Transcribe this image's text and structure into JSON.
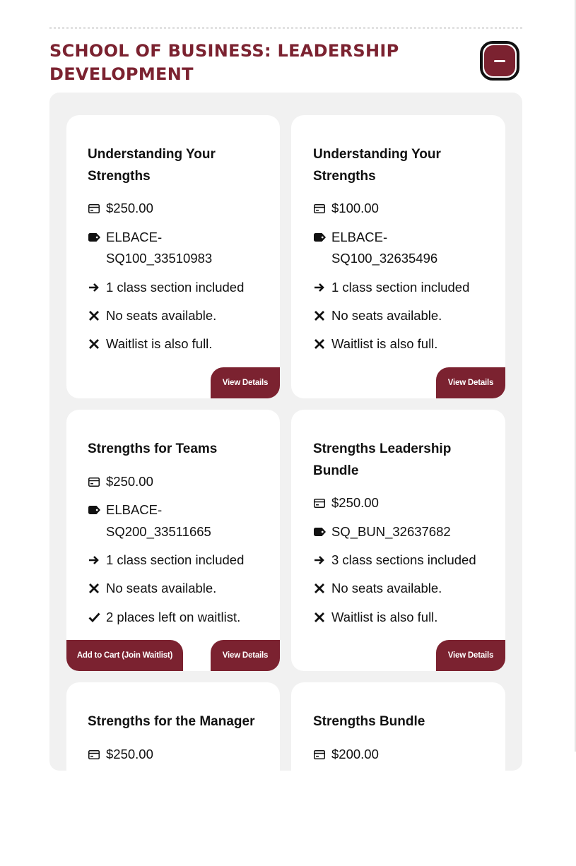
{
  "section": {
    "title": "School of Business: Leadership Development"
  },
  "cards": [
    {
      "title": "Understanding Your Strengths",
      "price": "$250.00",
      "code_line1": "ELBACE-",
      "code_line2": "SQ100_33510983",
      "sections": "1 class section included",
      "seats": "No seats available.",
      "waitlist": "Waitlist is also full.",
      "view_label": "View Details"
    },
    {
      "title": "Understanding Your Strengths",
      "price": "$100.00",
      "code_line1": "ELBACE-",
      "code_line2": "SQ100_32635496",
      "sections": "1 class section included",
      "seats": "No seats available.",
      "waitlist": "Waitlist is also full.",
      "view_label": "View Details"
    },
    {
      "title": "Strengths for Teams",
      "price": "$250.00",
      "code_line1": "ELBACE-",
      "code_line2": "SQ200_33511665",
      "sections": "1 class section included",
      "seats": "No seats available.",
      "waitlist": "2 places left on waitlist.",
      "cart_label": "Add to Cart (Join Waitlist)",
      "view_label": "View Details"
    },
    {
      "title": "Strengths Leadership Bundle",
      "price": "$250.00",
      "code_line1": "SQ_BUN_32637682",
      "sections": "3 class sections included",
      "seats": "No seats available.",
      "waitlist": "Waitlist is also full.",
      "view_label": "View Details"
    },
    {
      "title": "Strengths for the Manager",
      "price": "$250.00"
    },
    {
      "title": "Strengths Bundle",
      "price": "$200.00"
    }
  ],
  "icons": {
    "price": "credit-card-icon",
    "code": "tag-icon",
    "sections": "arrow-right-icon",
    "unavailable": "x-icon",
    "available": "check-icon"
  },
  "colors": {
    "accent": "#7b2230",
    "panel": "#f1f1f1",
    "card": "#ffffff"
  }
}
